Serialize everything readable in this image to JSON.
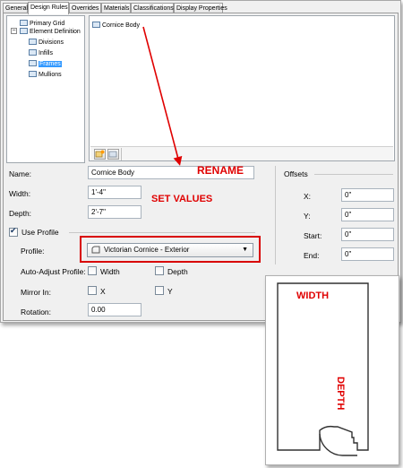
{
  "tabs": [
    {
      "label": "General",
      "active": false
    },
    {
      "label": "Design Rules",
      "active": true
    },
    {
      "label": "Overrides",
      "active": false
    },
    {
      "label": "Materials",
      "active": false
    },
    {
      "label": "Classifications",
      "active": false
    },
    {
      "label": "Display Properties",
      "active": false
    }
  ],
  "tree": {
    "items": [
      {
        "label": "Primary Grid",
        "icon": "grid-icon"
      },
      {
        "label": "Element Definition",
        "icon": "element-icon"
      },
      {
        "label": "Divisions",
        "icon": "divisions-icon"
      },
      {
        "label": "Infills",
        "icon": "infills-icon"
      },
      {
        "label": "Frames",
        "icon": "frames-icon",
        "selected": true
      },
      {
        "label": "Mullions",
        "icon": "mullions-icon"
      }
    ]
  },
  "list": {
    "items": [
      {
        "label": "Cornice Body",
        "icon": "frame-item-icon"
      }
    ],
    "toolbar": [
      "new-item-icon",
      "remove-item-icon"
    ]
  },
  "form": {
    "name_label": "Name:",
    "name_value": "Cornice Body",
    "width_label": "Width:",
    "width_value": "1'-4\"",
    "depth_label": "Depth:",
    "depth_value": "2'-7\"",
    "use_profile_label": "Use Profile",
    "use_profile_checked": true,
    "profile_label": "Profile:",
    "profile_value": "Victorian Cornice - Exterior",
    "auto_adjust_label": "Auto-Adjust Profile:",
    "auto_width_label": "Width",
    "auto_width_checked": false,
    "auto_depth_label": "Depth",
    "auto_depth_checked": false,
    "mirror_label": "Mirror In:",
    "mirror_x_label": "X",
    "mirror_x_checked": false,
    "mirror_y_label": "Y",
    "mirror_y_checked": false,
    "rotation_label": "Rotation:",
    "rotation_value": "0.00"
  },
  "offsets": {
    "title": "Offsets",
    "x_label": "X:",
    "x_value": "0\"",
    "y_label": "Y:",
    "y_value": "0\"",
    "start_label": "Start:",
    "start_value": "0\"",
    "end_label": "End:",
    "end_value": "0\""
  },
  "annotations": {
    "rename": "RENAME",
    "set_values": "SET VALUES",
    "width": "WIDTH",
    "depth": "DEPTH",
    "color": "#e00000"
  }
}
